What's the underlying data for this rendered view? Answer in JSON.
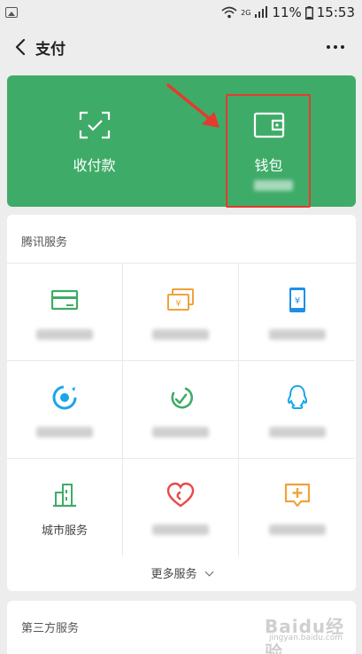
{
  "status_bar": {
    "battery": "11%",
    "time": "15:53",
    "signal_label": "2G"
  },
  "nav": {
    "title": "支付"
  },
  "pay_card": {
    "receive_pay_label": "收付款",
    "wallet_label": "钱包"
  },
  "tencent_services": {
    "title": "腾讯服务",
    "items": [
      {
        "icon": "credit-card-repay-icon",
        "color": "#3fab68"
      },
      {
        "icon": "wealth-management-icon",
        "color": "#f0a23b"
      },
      {
        "icon": "mobile-topup-icon",
        "color": "#1e8fe8"
      },
      {
        "icon": "utilities-icon",
        "color": "#1aa6e8"
      },
      {
        "icon": "qq-coin-icon",
        "color": "#3fab68"
      },
      {
        "icon": "qq-icon",
        "color": "#1aa6e8"
      },
      {
        "icon": "city-services-icon",
        "label": "城市服务",
        "color": "#3fab68"
      },
      {
        "icon": "charity-icon",
        "color": "#e84a4a"
      },
      {
        "icon": "medical-icon",
        "color": "#f0a23b"
      }
    ],
    "more_label": "更多服务"
  },
  "third_party": {
    "title": "第三方服务"
  },
  "watermark": {
    "text": "Baidu经验",
    "url": "jingyan.baidu.com"
  }
}
